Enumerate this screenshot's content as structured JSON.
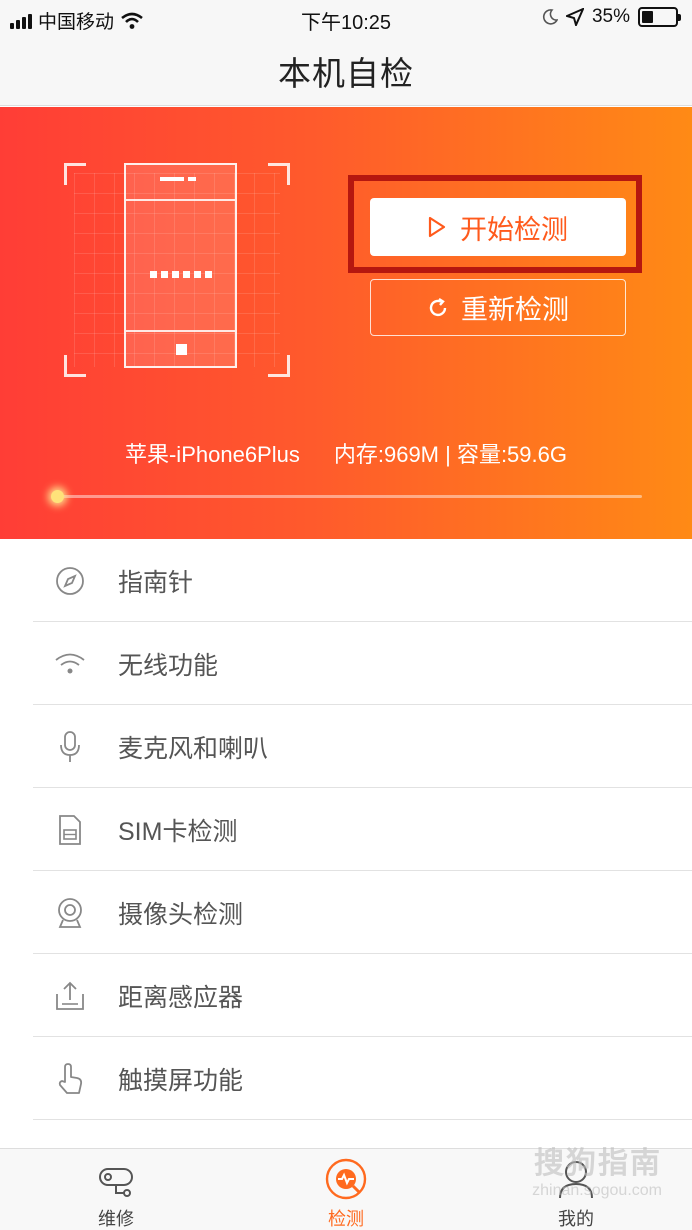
{
  "status_bar": {
    "carrier": "中国移动",
    "time": "下午10:25",
    "battery": "35%",
    "battery_level": 0.35
  },
  "nav": {
    "title": "本机自检"
  },
  "hero": {
    "start_button": "开始检测",
    "restart_button": "重新检测",
    "device_model": "苹果-iPhone6Plus",
    "device_storage": "内存:969M | 容量:59.6G",
    "progress": 0.0
  },
  "list": {
    "items": [
      {
        "label": "指南针",
        "icon": "compass-icon"
      },
      {
        "label": "无线功能",
        "icon": "wifi-icon"
      },
      {
        "label": "麦克风和喇叭",
        "icon": "microphone-icon"
      },
      {
        "label": "SIM卡检测",
        "icon": "sim-card-icon"
      },
      {
        "label": "摄像头检测",
        "icon": "camera-icon"
      },
      {
        "label": "距离感应器",
        "icon": "proximity-sensor-icon"
      },
      {
        "label": "触摸屏功能",
        "icon": "touch-icon"
      }
    ]
  },
  "tabs": {
    "items": [
      {
        "label": "维修",
        "icon": "repair-icon",
        "active": false
      },
      {
        "label": "检测",
        "icon": "detect-icon",
        "active": true
      },
      {
        "label": "我的",
        "icon": "profile-icon",
        "active": false
      }
    ]
  },
  "colors": {
    "accent": "#ff6a1f",
    "gradient_start": "#ff3d36",
    "gradient_end": "#ff8a15",
    "highlight": "#b5170f"
  },
  "watermark": {
    "text": "搜狗指南",
    "sub": "zhinan.sogou.com"
  }
}
